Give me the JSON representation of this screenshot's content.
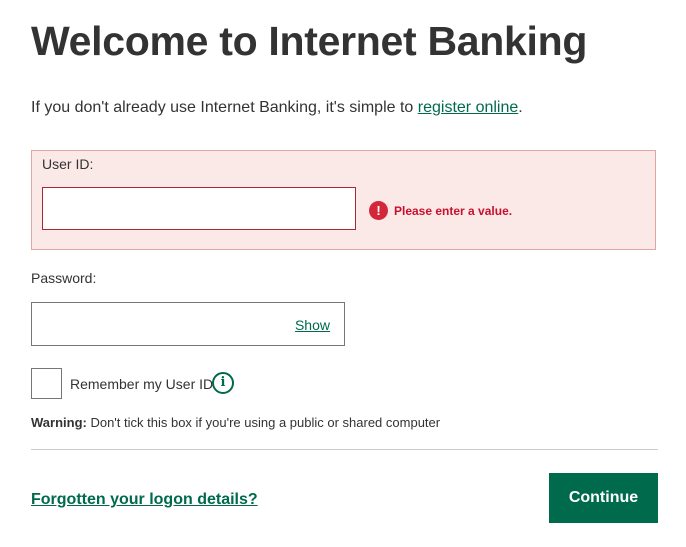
{
  "page": {
    "title": "Welcome to Internet Banking",
    "intro_text": "If you don't already use Internet Banking, it's simple to ",
    "register_link": "register online",
    "intro_suffix": "."
  },
  "form": {
    "user_id": {
      "label": "User ID:",
      "value": "",
      "error": "Please enter a value.",
      "error_icon": "alert-icon"
    },
    "password": {
      "label": "Password:",
      "value": "",
      "show_label": "Show"
    },
    "remember": {
      "label": "Remember my User ID",
      "checked": false,
      "info_icon": "info-icon",
      "info_glyph": "i"
    },
    "warning": {
      "prefix": "Warning:",
      "text": " Don't tick this box if you're using a public or shared computer"
    }
  },
  "footer": {
    "forgot_link": "Forgotten your logon details?",
    "continue_label": "Continue"
  },
  "colors": {
    "brand_green": "#006a4d",
    "error_red": "#c8102e",
    "error_bg": "#fbe9e8"
  }
}
